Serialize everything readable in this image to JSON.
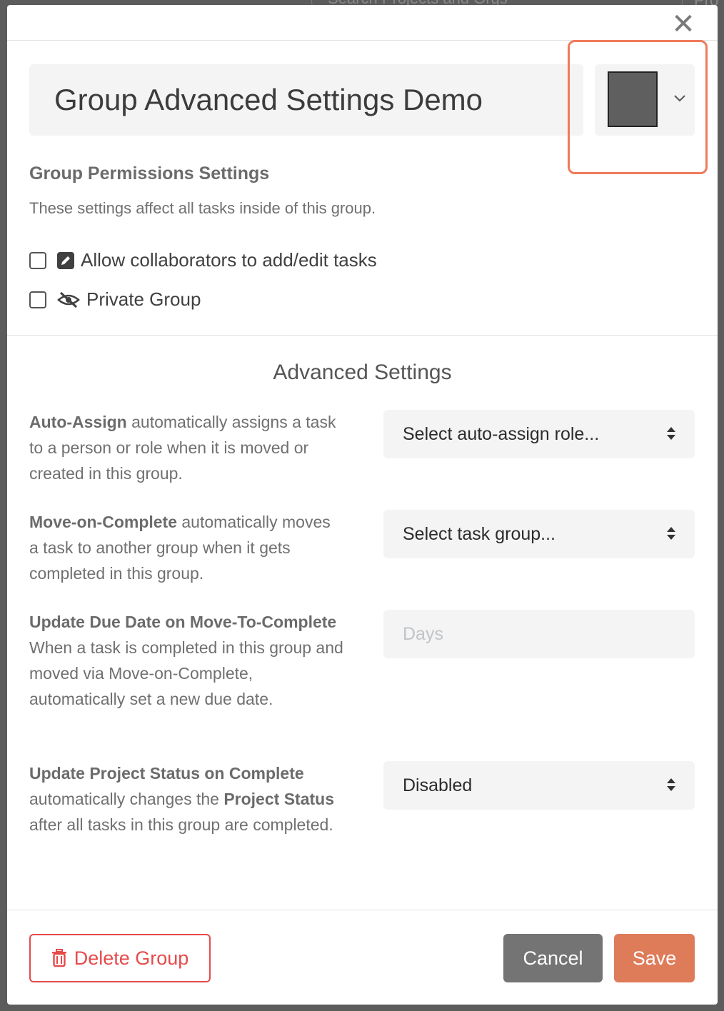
{
  "background": {
    "search_text": "Search Projects and Orgs",
    "right_text": "Pro"
  },
  "modal": {
    "close_glyph": "✕",
    "group_name": "Group Advanced Settings Demo",
    "group_color": "#5f5f5f",
    "permissions": {
      "title": "Group Permissions Settings",
      "description": "These settings affect all tasks inside of this group.",
      "allow_collaborators_label": "Allow collaborators to add/edit tasks",
      "allow_collaborators_checked": false,
      "private_group_label": "Private Group",
      "private_group_checked": false
    },
    "advanced": {
      "title": "Advanced Settings",
      "auto_assign": {
        "bold": "Auto-Assign",
        "rest": " automatically assigns a task to a person or role when it is moved or created in this group.",
        "select_value": "Select auto-assign role..."
      },
      "move_on_complete": {
        "bold": "Move-on-Complete",
        "rest": " automatically moves a task to another group when it gets completed in this group.",
        "select_value": "Select task group..."
      },
      "update_due_date": {
        "bold": "Update Due Date on Move-To-Complete",
        "rest": " When a task is completed in this group and moved via Move-on-Complete, automatically set a new due date.",
        "input_placeholder": "Days"
      },
      "update_project_status": {
        "bold1": "Update Project Status on Complete",
        "mid": " automatically changes the ",
        "bold2": "Project Status",
        "rest": " after all tasks in this group are completed.",
        "select_value": "Disabled"
      }
    },
    "footer": {
      "delete_label": "Delete Group",
      "cancel_label": "Cancel",
      "save_label": "Save"
    }
  },
  "colors": {
    "accent": "#de7c5a",
    "danger": "#e54b4b",
    "highlight": "#f07a5a"
  }
}
